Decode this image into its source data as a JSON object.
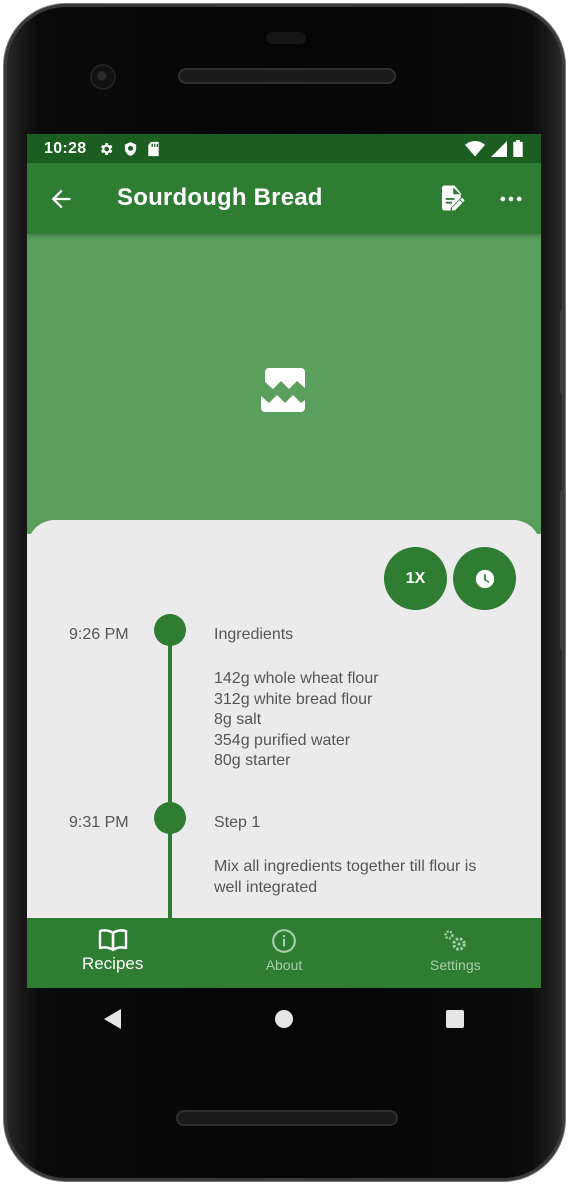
{
  "status_bar": {
    "time": "10:28",
    "icons_left": [
      "gear-icon",
      "shield-icon",
      "sd-card-icon"
    ],
    "icons_right": [
      "wifi-icon",
      "cell-signal-icon",
      "battery-icon"
    ]
  },
  "app_bar": {
    "title": "Sourdough Bread",
    "icons": [
      "back-arrow-icon",
      "edit-document-icon",
      "more-horizontal-icon"
    ]
  },
  "hero": {
    "icon": "broken-image-icon"
  },
  "actions": {
    "scale_label": "1X",
    "timer_icon": "clock-icon"
  },
  "timeline": [
    {
      "time": "9:26 PM",
      "title": "Ingredients",
      "lines": [
        "142g whole wheat flour",
        "312g white bread flour",
        "8g salt",
        "354g purified water",
        "80g starter"
      ]
    },
    {
      "time": "9:31 PM",
      "title": "Step 1",
      "lines": [
        "Mix all ingredients together till flour is",
        "well integrated"
      ]
    }
  ],
  "bottom_nav": {
    "items": [
      {
        "label": "Recipes",
        "icon": "book-icon",
        "active": true
      },
      {
        "label": "About",
        "icon": "info-icon",
        "active": false
      },
      {
        "label": "Settings",
        "icon": "gears-icon",
        "active": false
      }
    ]
  },
  "system_nav": [
    "back-triangle-icon",
    "home-circle-icon",
    "recents-square-icon"
  ],
  "colors": {
    "primary": "#2e7d32",
    "primary_dark": "#1b5e20",
    "hero": "#5aa05c",
    "surface": "#ebebeb",
    "text_secondary": "#555555",
    "nav_inactive": "#a5cfa7"
  }
}
